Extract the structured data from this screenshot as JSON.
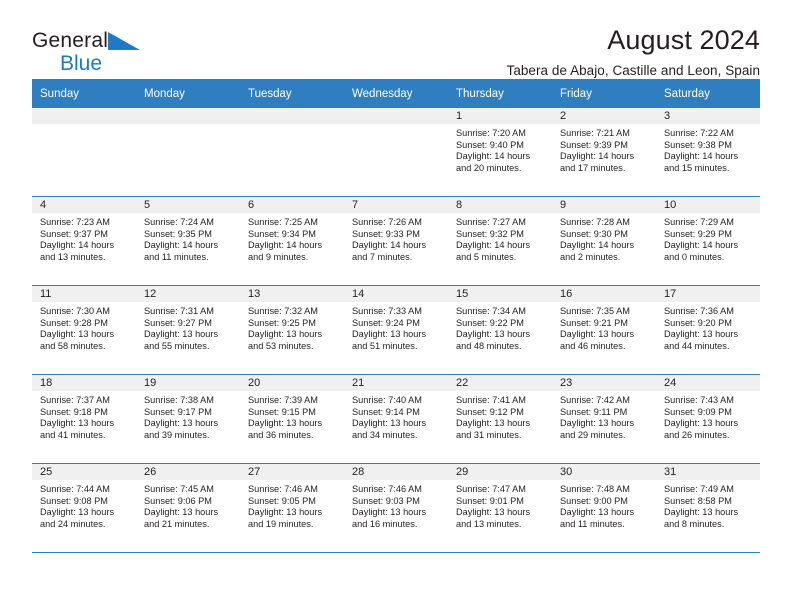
{
  "brand": {
    "name_part1": "General",
    "name_part2": "Blue",
    "triangle_color": "#1f79c4"
  },
  "header": {
    "title": "August 2024",
    "subtitle": "Tabera de Abajo, Castille and Leon, Spain"
  },
  "calendar": {
    "header_color": "#2f7ec0",
    "weekday_headers": [
      "Sunday",
      "Monday",
      "Tuesday",
      "Wednesday",
      "Thursday",
      "Friday",
      "Saturday"
    ],
    "weeks": [
      [
        {
          "day": "",
          "lines": []
        },
        {
          "day": "",
          "lines": []
        },
        {
          "day": "",
          "lines": []
        },
        {
          "day": "",
          "lines": []
        },
        {
          "day": "1",
          "lines": [
            "Sunrise: 7:20 AM",
            "Sunset: 9:40 PM",
            "Daylight: 14 hours",
            "and 20 minutes."
          ]
        },
        {
          "day": "2",
          "lines": [
            "Sunrise: 7:21 AM",
            "Sunset: 9:39 PM",
            "Daylight: 14 hours",
            "and 17 minutes."
          ]
        },
        {
          "day": "3",
          "lines": [
            "Sunrise: 7:22 AM",
            "Sunset: 9:38 PM",
            "Daylight: 14 hours",
            "and 15 minutes."
          ]
        }
      ],
      [
        {
          "day": "4",
          "lines": [
            "Sunrise: 7:23 AM",
            "Sunset: 9:37 PM",
            "Daylight: 14 hours",
            "and 13 minutes."
          ]
        },
        {
          "day": "5",
          "lines": [
            "Sunrise: 7:24 AM",
            "Sunset: 9:35 PM",
            "Daylight: 14 hours",
            "and 11 minutes."
          ]
        },
        {
          "day": "6",
          "lines": [
            "Sunrise: 7:25 AM",
            "Sunset: 9:34 PM",
            "Daylight: 14 hours",
            "and 9 minutes."
          ]
        },
        {
          "day": "7",
          "lines": [
            "Sunrise: 7:26 AM",
            "Sunset: 9:33 PM",
            "Daylight: 14 hours",
            "and 7 minutes."
          ]
        },
        {
          "day": "8",
          "lines": [
            "Sunrise: 7:27 AM",
            "Sunset: 9:32 PM",
            "Daylight: 14 hours",
            "and 5 minutes."
          ]
        },
        {
          "day": "9",
          "lines": [
            "Sunrise: 7:28 AM",
            "Sunset: 9:30 PM",
            "Daylight: 14 hours",
            "and 2 minutes."
          ]
        },
        {
          "day": "10",
          "lines": [
            "Sunrise: 7:29 AM",
            "Sunset: 9:29 PM",
            "Daylight: 14 hours",
            "and 0 minutes."
          ]
        }
      ],
      [
        {
          "day": "11",
          "lines": [
            "Sunrise: 7:30 AM",
            "Sunset: 9:28 PM",
            "Daylight: 13 hours",
            "and 58 minutes."
          ]
        },
        {
          "day": "12",
          "lines": [
            "Sunrise: 7:31 AM",
            "Sunset: 9:27 PM",
            "Daylight: 13 hours",
            "and 55 minutes."
          ]
        },
        {
          "day": "13",
          "lines": [
            "Sunrise: 7:32 AM",
            "Sunset: 9:25 PM",
            "Daylight: 13 hours",
            "and 53 minutes."
          ]
        },
        {
          "day": "14",
          "lines": [
            "Sunrise: 7:33 AM",
            "Sunset: 9:24 PM",
            "Daylight: 13 hours",
            "and 51 minutes."
          ]
        },
        {
          "day": "15",
          "lines": [
            "Sunrise: 7:34 AM",
            "Sunset: 9:22 PM",
            "Daylight: 13 hours",
            "and 48 minutes."
          ]
        },
        {
          "day": "16",
          "lines": [
            "Sunrise: 7:35 AM",
            "Sunset: 9:21 PM",
            "Daylight: 13 hours",
            "and 46 minutes."
          ]
        },
        {
          "day": "17",
          "lines": [
            "Sunrise: 7:36 AM",
            "Sunset: 9:20 PM",
            "Daylight: 13 hours",
            "and 44 minutes."
          ]
        }
      ],
      [
        {
          "day": "18",
          "lines": [
            "Sunrise: 7:37 AM",
            "Sunset: 9:18 PM",
            "Daylight: 13 hours",
            "and 41 minutes."
          ]
        },
        {
          "day": "19",
          "lines": [
            "Sunrise: 7:38 AM",
            "Sunset: 9:17 PM",
            "Daylight: 13 hours",
            "and 39 minutes."
          ]
        },
        {
          "day": "20",
          "lines": [
            "Sunrise: 7:39 AM",
            "Sunset: 9:15 PM",
            "Daylight: 13 hours",
            "and 36 minutes."
          ]
        },
        {
          "day": "21",
          "lines": [
            "Sunrise: 7:40 AM",
            "Sunset: 9:14 PM",
            "Daylight: 13 hours",
            "and 34 minutes."
          ]
        },
        {
          "day": "22",
          "lines": [
            "Sunrise: 7:41 AM",
            "Sunset: 9:12 PM",
            "Daylight: 13 hours",
            "and 31 minutes."
          ]
        },
        {
          "day": "23",
          "lines": [
            "Sunrise: 7:42 AM",
            "Sunset: 9:11 PM",
            "Daylight: 13 hours",
            "and 29 minutes."
          ]
        },
        {
          "day": "24",
          "lines": [
            "Sunrise: 7:43 AM",
            "Sunset: 9:09 PM",
            "Daylight: 13 hours",
            "and 26 minutes."
          ]
        }
      ],
      [
        {
          "day": "25",
          "lines": [
            "Sunrise: 7:44 AM",
            "Sunset: 9:08 PM",
            "Daylight: 13 hours",
            "and 24 minutes."
          ]
        },
        {
          "day": "26",
          "lines": [
            "Sunrise: 7:45 AM",
            "Sunset: 9:06 PM",
            "Daylight: 13 hours",
            "and 21 minutes."
          ]
        },
        {
          "day": "27",
          "lines": [
            "Sunrise: 7:46 AM",
            "Sunset: 9:05 PM",
            "Daylight: 13 hours",
            "and 19 minutes."
          ]
        },
        {
          "day": "28",
          "lines": [
            "Sunrise: 7:46 AM",
            "Sunset: 9:03 PM",
            "Daylight: 13 hours",
            "and 16 minutes."
          ]
        },
        {
          "day": "29",
          "lines": [
            "Sunrise: 7:47 AM",
            "Sunset: 9:01 PM",
            "Daylight: 13 hours",
            "and 13 minutes."
          ]
        },
        {
          "day": "30",
          "lines": [
            "Sunrise: 7:48 AM",
            "Sunset: 9:00 PM",
            "Daylight: 13 hours",
            "and 11 minutes."
          ]
        },
        {
          "day": "31",
          "lines": [
            "Sunrise: 7:49 AM",
            "Sunset: 8:58 PM",
            "Daylight: 13 hours",
            "and 8 minutes."
          ]
        }
      ]
    ]
  }
}
